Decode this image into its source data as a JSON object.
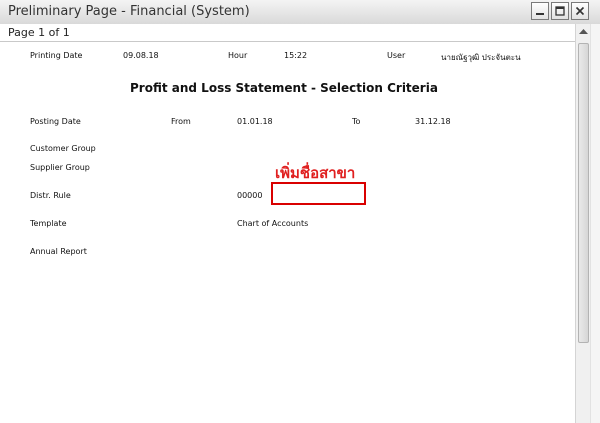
{
  "window": {
    "title": "Preliminary Page - Financial (System)"
  },
  "pagination": {
    "label": "Page 1 of 1"
  },
  "report_header": {
    "printing_date_label": "Printing Date",
    "printing_date_value": "09.08.18",
    "hour_label": "Hour",
    "hour_value": "15:22",
    "user_label": "User",
    "user_value": "นายณัฐวุฒิ ประจันตะน"
  },
  "report": {
    "title": "Profit and Loss Statement - Selection Criteria",
    "posting_date_label": "Posting Date",
    "from_label": "From",
    "from_value": "01.01.18",
    "to_label": "To",
    "to_value": "31.12.18",
    "customer_group_label": "Customer Group",
    "supplier_group_label": "Supplier Group",
    "distr_rule_label": "Distr. Rule",
    "distr_rule_value": "00000",
    "template_label": "Template",
    "template_value": "Chart of Accounts",
    "annual_report_label": "Annual Report"
  },
  "annotation": {
    "text": "เพิ่มชื่อสาขา",
    "color": "#e02020"
  },
  "icons": {
    "minimize": "minimize-icon",
    "maximize": "maximize-icon",
    "close": "close-icon",
    "scroll_up": "scroll-up-arrow-icon"
  }
}
